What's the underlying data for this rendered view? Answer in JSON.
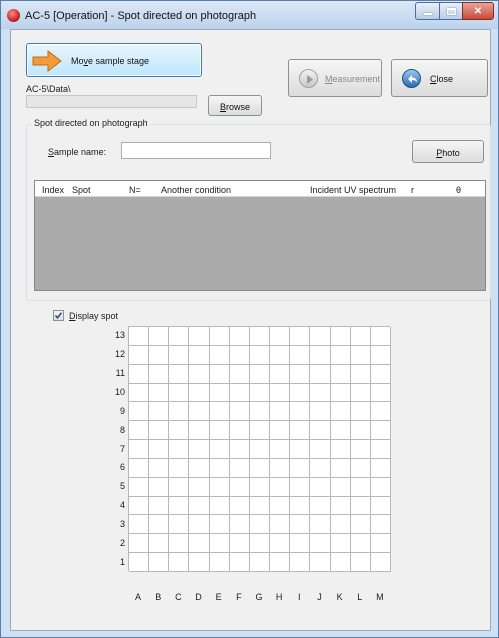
{
  "window": {
    "title": "AC-5 [Operation] - Spot directed on photograph"
  },
  "toolbar": {
    "move_stage_label_pre": "Mo",
    "move_stage_label_mnemonic": "v",
    "move_stage_label_post": "e sample stage",
    "path": "AC-5\\Data\\",
    "path_value": "",
    "browse_label_mnemonic": "B",
    "browse_label_post": "rowse",
    "measurement_label_mnemonic": "M",
    "measurement_label_post": "easurement",
    "close_label_mnemonic": "C",
    "close_label_post": "lose"
  },
  "group": {
    "title": "Spot directed on photograph",
    "sample_label_mnemonic": "S",
    "sample_label_post": "ample name:",
    "sample_value": "",
    "photo_label_mnemonic": "P",
    "photo_label_post": "hoto"
  },
  "table": {
    "columns": [
      "Index",
      "Spot",
      "N=",
      "Another condition",
      "Incident UV spectrum",
      "r",
      "θ"
    ],
    "rows": []
  },
  "display": {
    "checked": true,
    "label_mnemonic": "D",
    "label_post": "isplay spot"
  },
  "grid": {
    "rows": [
      "13",
      "12",
      "11",
      "10",
      "9",
      "8",
      "7",
      "6",
      "5",
      "4",
      "3",
      "2",
      "1"
    ],
    "cols": [
      "A",
      "B",
      "C",
      "D",
      "E",
      "F",
      "G",
      "H",
      "I",
      "J",
      "K",
      "L",
      "M"
    ]
  },
  "colors": {
    "title_bar": "#bcd3ec",
    "client": "#f0f0f0",
    "table_body": "#ababab",
    "move_arrow": "#f59a3a",
    "close_icon": "#2a6bb0"
  }
}
